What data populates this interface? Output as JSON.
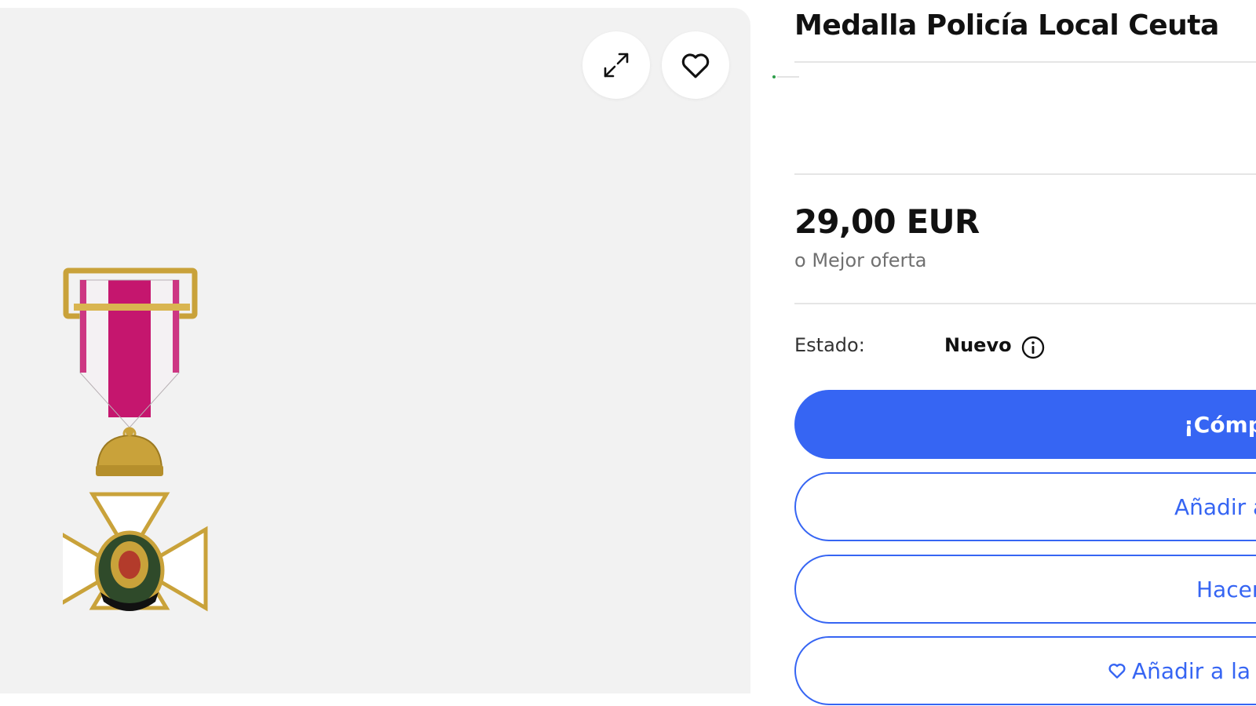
{
  "listing": {
    "title": "Medalla Policía Local Ceuta",
    "price": "29,00 EUR",
    "best_offer": "o Mejor oferta",
    "condition_label": "Estado:",
    "condition_value": "Nuevo"
  },
  "gallery": {
    "expand_icon": "expand-icon",
    "favorite_icon": "heart-icon",
    "image_description": "medal-image"
  },
  "actions": {
    "buy_now": "¡Cómpralo ya!",
    "add_to_cart": "Añadir a la cesta",
    "make_offer": "Hacer una oferta",
    "add_to_watchlist": "Añadir a la lista de seguimiento"
  },
  "colors": {
    "primary": "#3665f3",
    "gallery_bg": "#f2f2f2",
    "ribbon": "#c5166e",
    "gold": "#c9a23a"
  }
}
